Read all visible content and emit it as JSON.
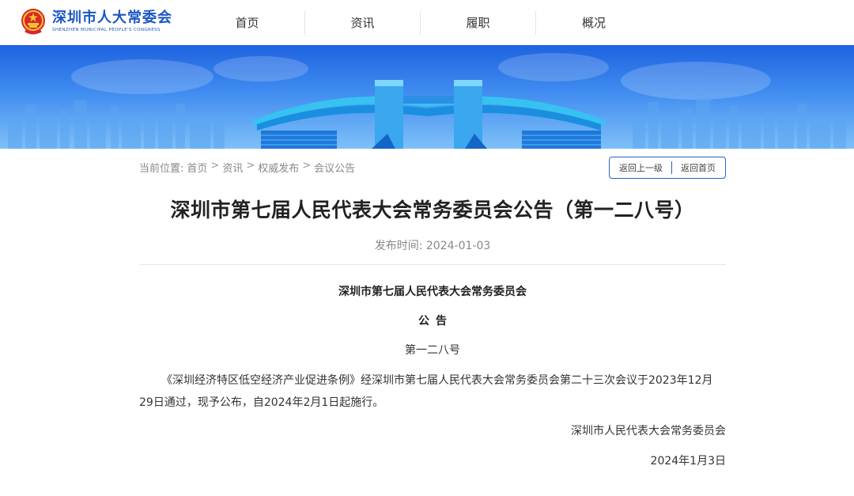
{
  "header": {
    "logo_cn": "深圳市人大常委会",
    "logo_en": "SHENZHEN MUNICIPAL PEOPLE'S CONGRESS",
    "nav": [
      "首页",
      "资讯",
      "履职",
      "概况"
    ]
  },
  "breadcrumb": {
    "label": "当前位置:",
    "items": [
      "首页",
      "资讯",
      "权威发布",
      "会议公告"
    ],
    "separator": ">",
    "back_up": "返回上一级",
    "back_home": "返回首页"
  },
  "article": {
    "title": "深圳市第七届人民代表大会常务委员会公告（第一二八号）",
    "publish_label": "发布时间:",
    "publish_date": "2024-01-03",
    "org": "深圳市第七届人民代表大会常务委员会",
    "doc_type": "公告",
    "doc_number": "第一二八号",
    "body": "《深圳经济特区低空经济产业促进条例》经深圳市第七届人民代表大会常务委员会第二十三次会议于2023年12月29日通过，现予公布，自2024年2月1日起施行。",
    "signature": "深圳市人民代表大会常务委员会",
    "sign_date": "2024年1月3日"
  },
  "colors": {
    "brand_blue": "#1a56c4",
    "button_border": "#2a62c8",
    "banner_top": "#1e63e0",
    "banner_bottom": "#7fc0f8"
  },
  "icons": [
    "national-emblem-icon"
  ]
}
